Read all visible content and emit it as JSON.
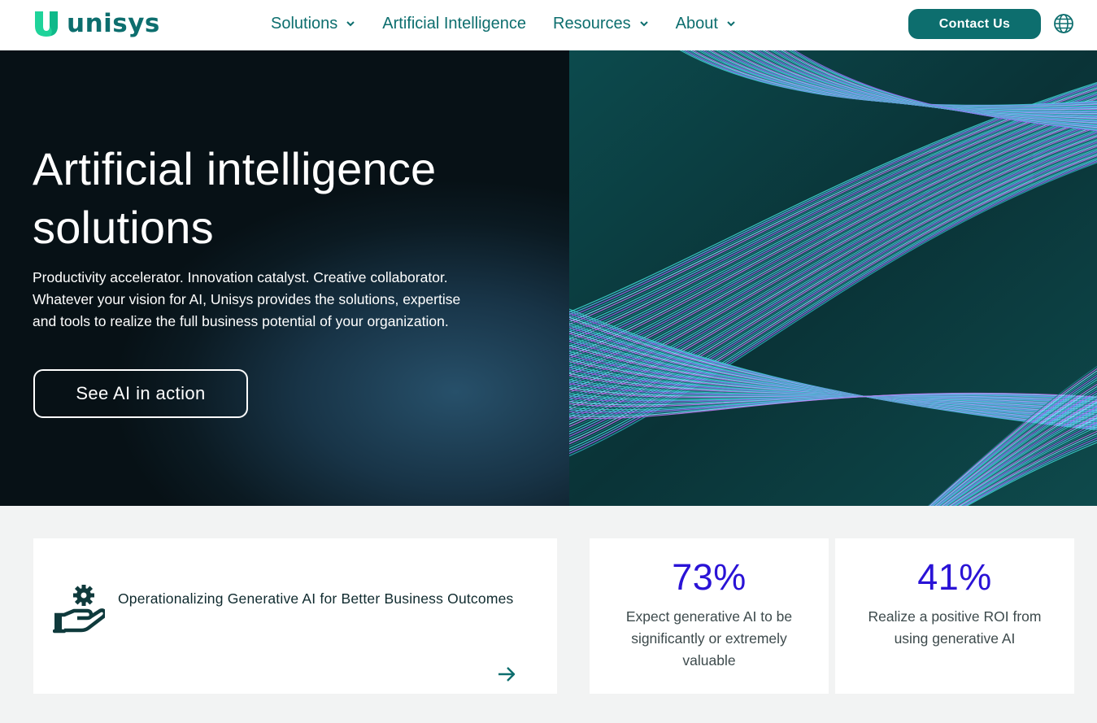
{
  "header": {
    "brand": "unisys",
    "nav": [
      {
        "label": "Solutions",
        "has_dropdown": true
      },
      {
        "label": "Artificial Intelligence",
        "has_dropdown": false
      },
      {
        "label": "Resources",
        "has_dropdown": true
      },
      {
        "label": "About",
        "has_dropdown": true
      }
    ],
    "contact_label": "Contact Us",
    "language_icon": "globe-icon"
  },
  "hero": {
    "title": "Artificial intelligence solutions",
    "description": "Productivity accelerator. Innovation catalyst. Creative collaborator. Whatever your vision for AI, Unisys provides the solutions, expertise and tools to realize the full business potential of your organization.",
    "cta_label": "See AI in action",
    "image_icon": "abstract-fiber-streams-image"
  },
  "feature_card": {
    "icon": "hand-gear-icon",
    "title": "Operationalizing Generative AI for Better Business Outcomes",
    "arrow_icon": "arrow-right-icon"
  },
  "stats": [
    {
      "value": "73%",
      "label": "Expect generative AI to be significantly or extremely valuable"
    },
    {
      "value": "41%",
      "label": "Realize a positive ROI from using generative AI"
    }
  ],
  "colors": {
    "brand_teal": "#0d6e6e",
    "stat_blue": "#2a13d6",
    "hero_dark": "#0b1a22",
    "page_bg": "#f2f3f3"
  }
}
